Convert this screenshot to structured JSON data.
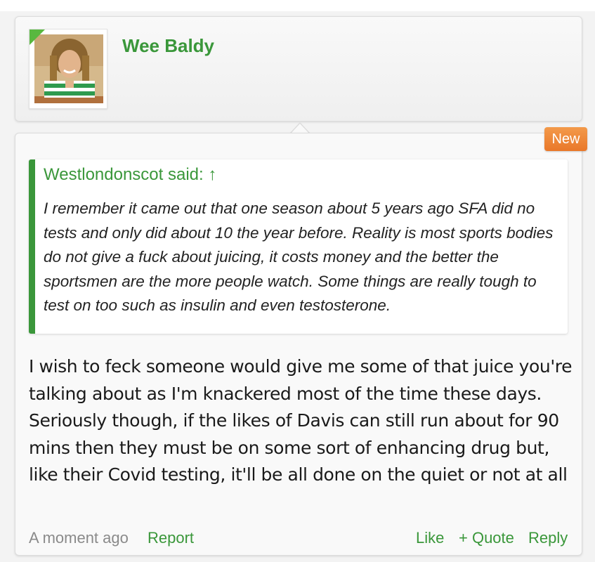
{
  "user": {
    "name": "Wee Baldy"
  },
  "message": {
    "badge": "New",
    "quote": {
      "author_line": "Westlondonscot said: ↑",
      "text": "I remember it came out that one season about 5 years ago SFA did no tests and only did about 10 the year before. Reality is most sports bodies do not give a fuck about juicing, it costs money and the better the sportsmen are the more people watch. Some things are really tough to test on too such as insulin and even testosterone."
    },
    "body": "I wish to feck someone would give me some of that juice you're talking about as I'm knackered most of the time these days. Seriously though, if the likes of Davis can still run about for 90 mins then they must be on some sort of enhancing drug but, like their Covid testing, it'll be all done on the quiet or not at all",
    "footer": {
      "timestamp": "A moment ago",
      "report_label": "Report",
      "like_label": "Like",
      "quote_label": "+ Quote",
      "reply_label": "Reply"
    }
  },
  "colors": {
    "accent_green": "#3a973a",
    "badge_orange": "#ee8533",
    "muted_text": "#8a8a8a"
  },
  "icons": {
    "avatar": "user-avatar-photo",
    "quote_jump": "up-arrow"
  }
}
